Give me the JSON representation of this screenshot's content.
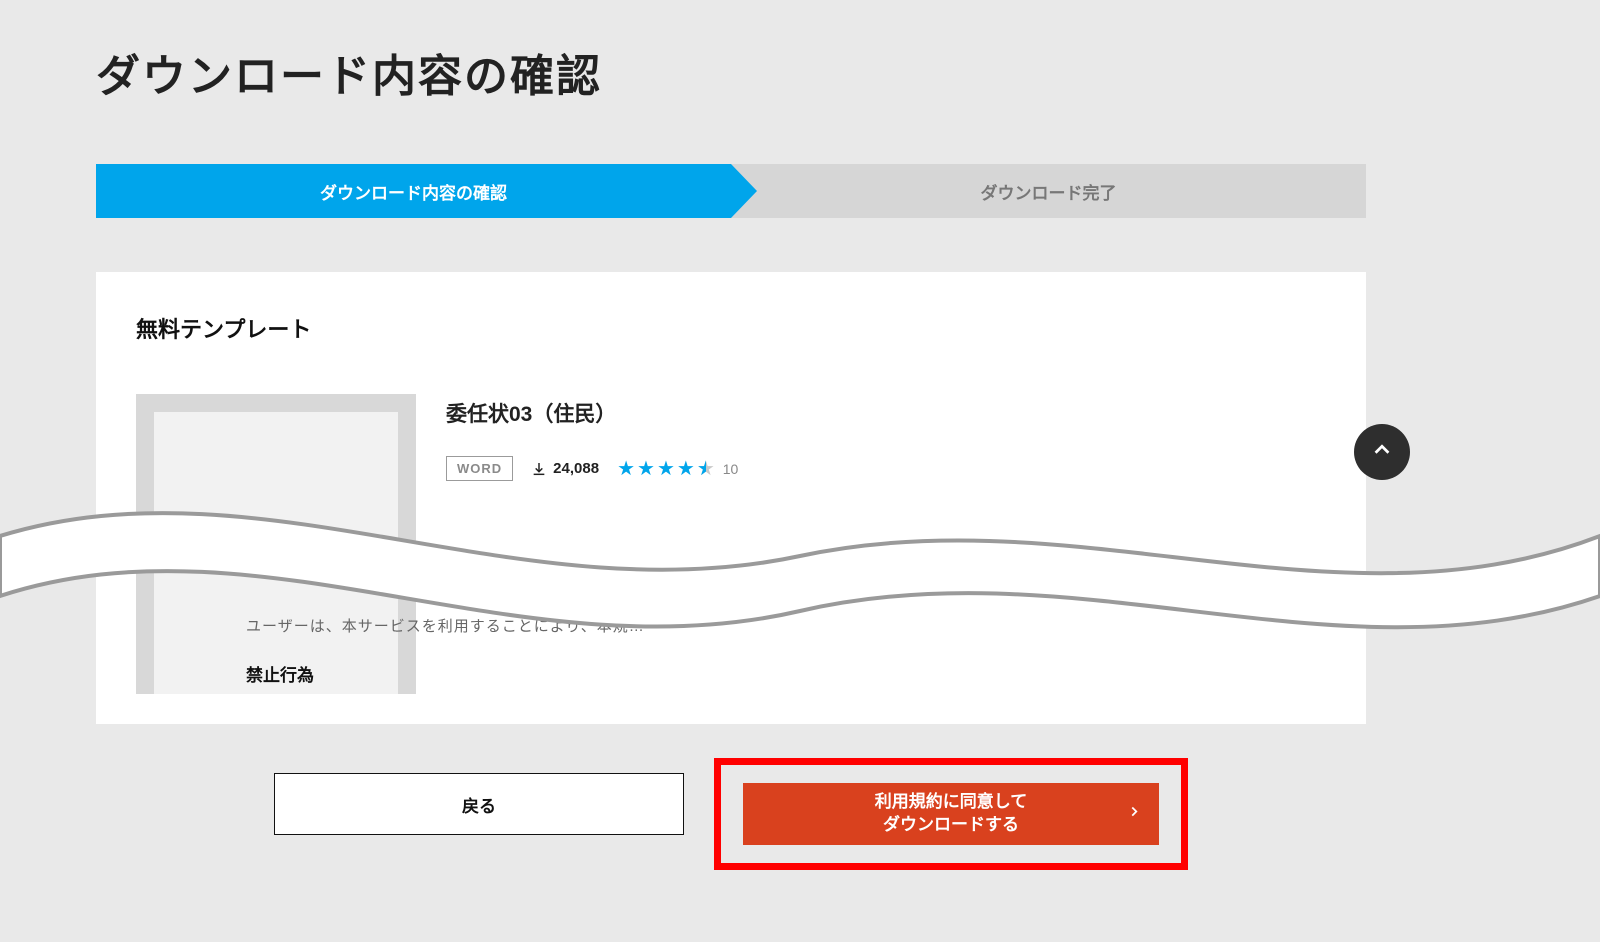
{
  "page": {
    "title": "ダウンロード内容の確認"
  },
  "stepper": {
    "active": "ダウンロード内容の確認",
    "inactive": "ダウンロード完了"
  },
  "card": {
    "subheading": "無料テンプレート",
    "item": {
      "title": "委任状03（住民）",
      "badge": "WORD",
      "downloads": "24,088",
      "rating_count": "10"
    },
    "terms_line": "ユーザーは、本サービスを利用することにより、本規…",
    "terms_heading": "禁止行為"
  },
  "buttons": {
    "back": "戻る",
    "download_line1": "利用規約に同意して",
    "download_line2": "ダウンロードする"
  }
}
